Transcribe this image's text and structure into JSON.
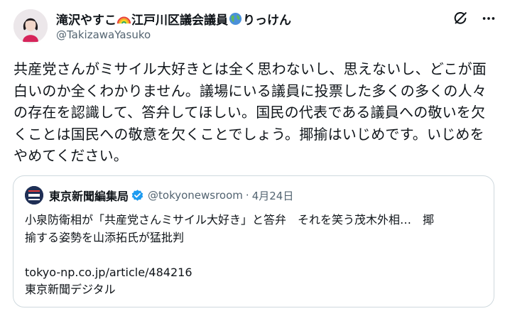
{
  "author": {
    "display_name_1": "滝沢やすこ",
    "display_name_2": "江戸川区議会議員",
    "display_name_3": "りっけん",
    "emoji_1": "rainbow",
    "emoji_2": "globe-americas",
    "handle": "@TakizawaYasuko"
  },
  "tweet": {
    "lines": [
      "共産党さんがミサイル大好きとは全く思わないし、思えないし、どこが面",
      "白いのか全くわかりません。議場にいる議員に投票した多くの多くの人々",
      "の存在を認識して、答弁してほしい。国民の代表である議員への敬いを欠",
      "くことは国民への敬意を欠くことでしょう。揶揄はいじめです。いじめを",
      "やめてください。"
    ]
  },
  "quote": {
    "name": "東京新聞編集局",
    "handle": "@tokyonewsroom",
    "separator": "·",
    "date": "4月24日",
    "lines": [
      "小泉防衛相が「共産党さんミサイル大好き」と答弁　それを笑う茂木外相…　揶",
      "揄する姿勢を山添拓氏が猛批判"
    ],
    "link": "tokyo-np.co.jp/article/484216",
    "source": "東京新聞デジタル"
  },
  "icons": {
    "grok": "grok-icon",
    "more": "more-icon",
    "verified": "verified-badge-icon"
  },
  "colors": {
    "text": "#0f1419",
    "secondary": "#536471",
    "border": "#cfd9de",
    "verified": "#1d9bf0"
  }
}
